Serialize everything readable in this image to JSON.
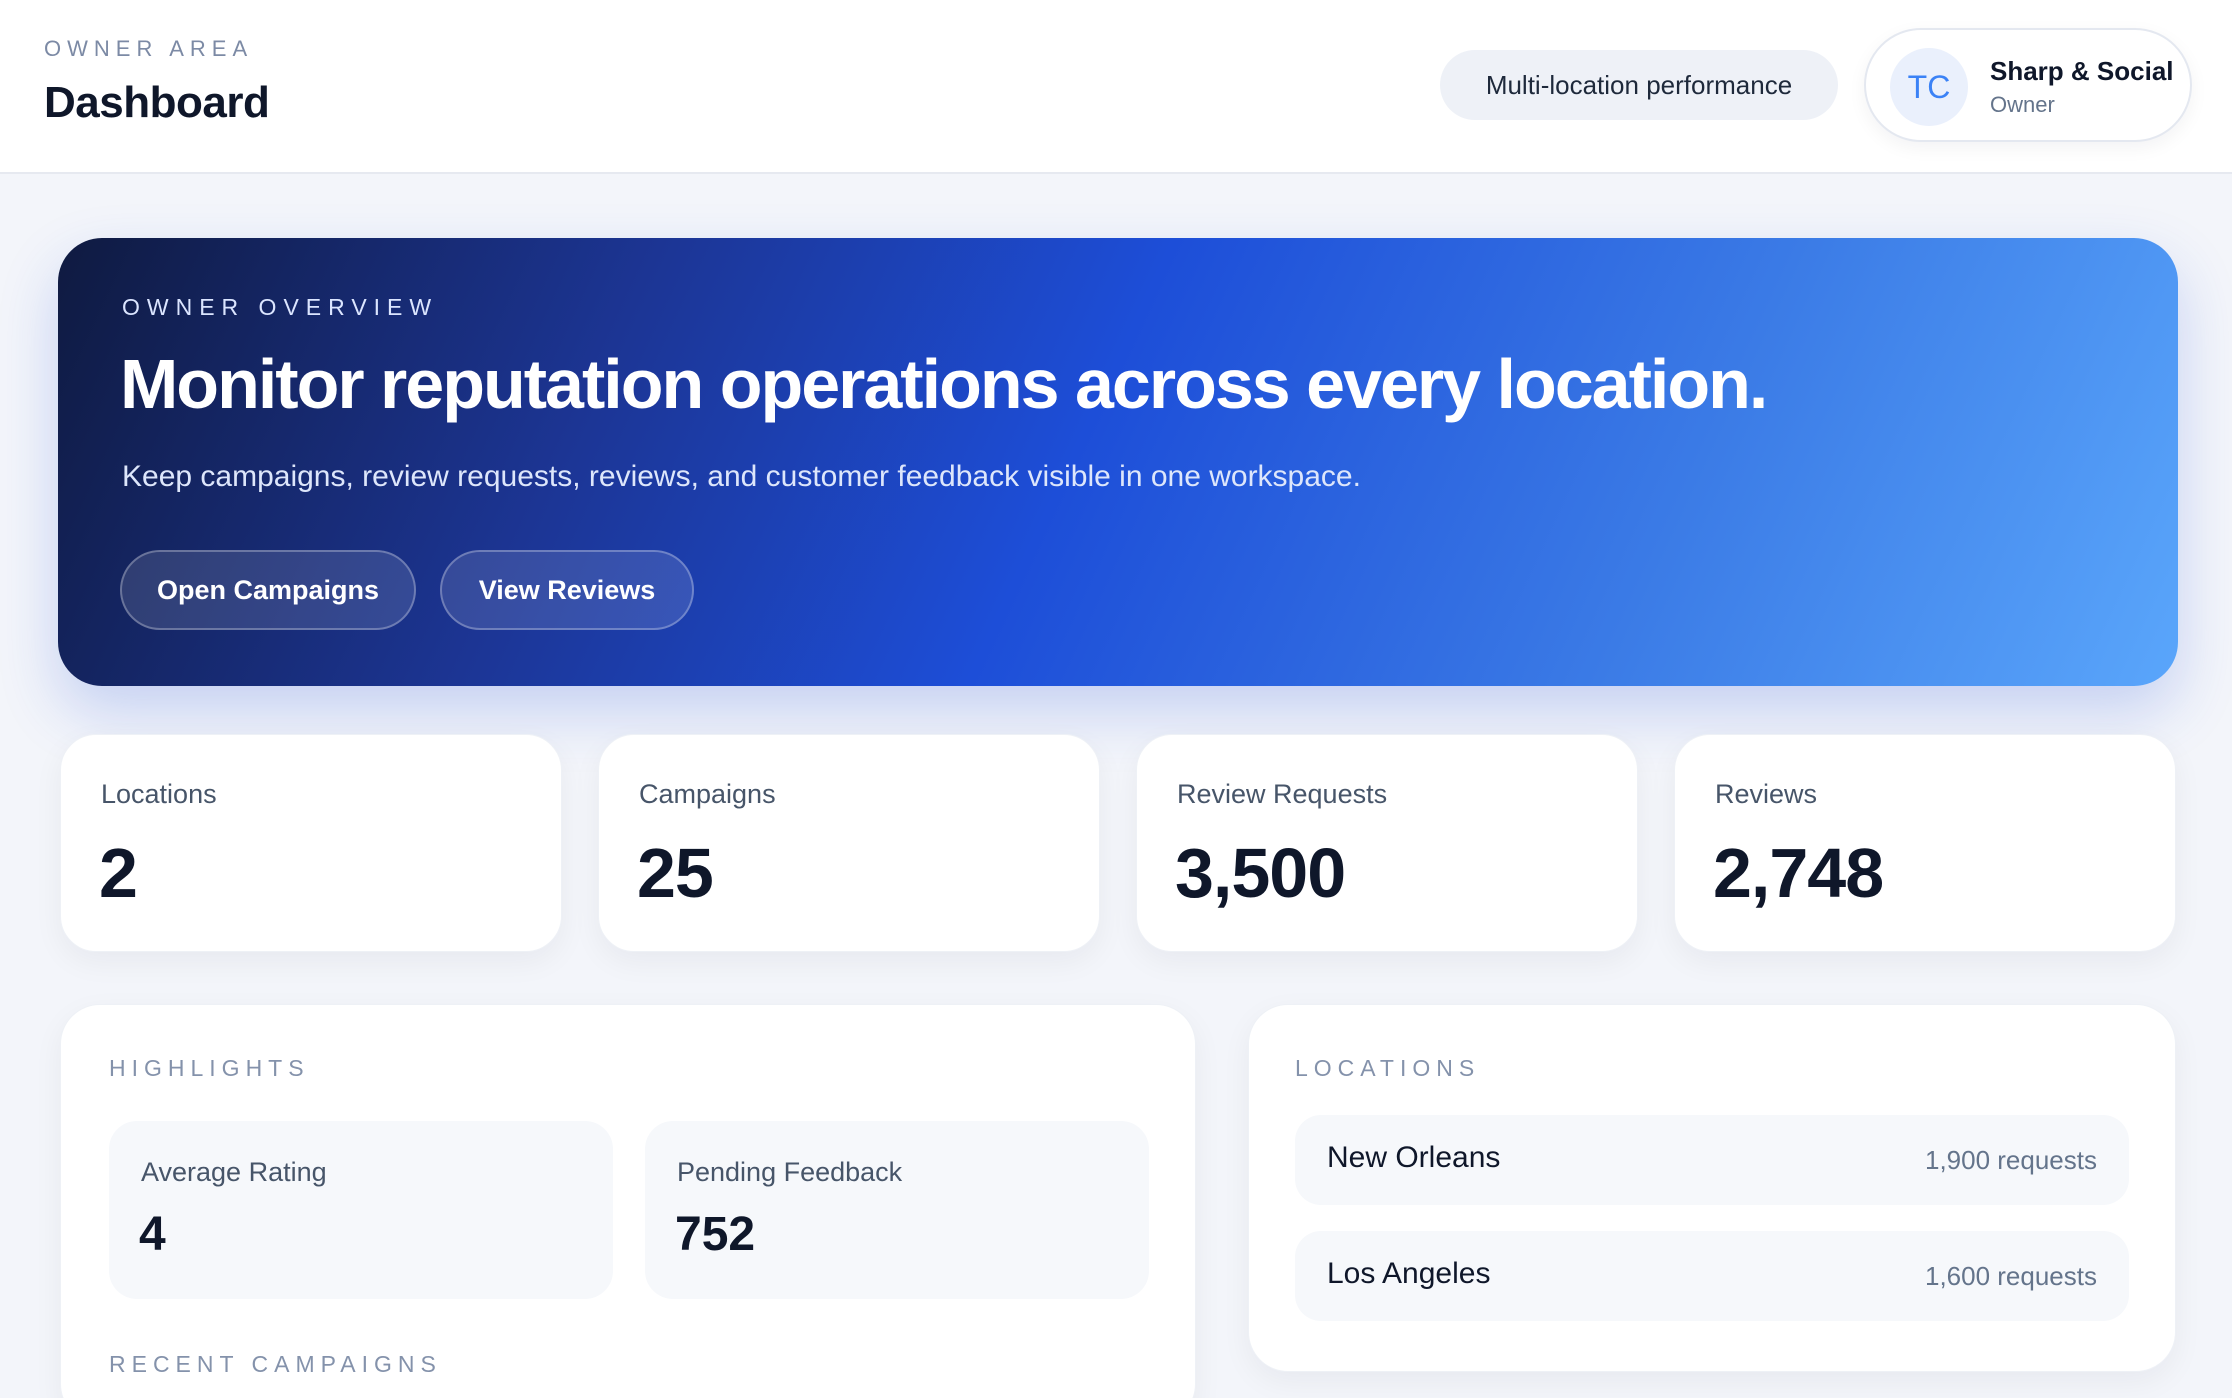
{
  "header": {
    "eyebrow": "OWNER AREA",
    "title": "Dashboard",
    "performance_pill": "Multi-location performance",
    "user": {
      "initials": "TC",
      "name": "Sharp & Social",
      "role": "Owner"
    }
  },
  "hero": {
    "eyebrow": "OWNER OVERVIEW",
    "title": "Monitor reputation operations across every location.",
    "subtitle": "Keep campaigns, review requests, reviews, and customer feedback visible in one workspace.",
    "buttons": [
      "Open Campaigns",
      "View Reviews"
    ]
  },
  "stats": [
    {
      "label": "Locations",
      "value": "2"
    },
    {
      "label": "Campaigns",
      "value": "25"
    },
    {
      "label": "Review Requests",
      "value": "3,500"
    },
    {
      "label": "Reviews",
      "value": "2,748"
    }
  ],
  "highlights": {
    "eyebrow": "HIGHLIGHTS",
    "items": [
      {
        "label": "Average Rating",
        "value": "4"
      },
      {
        "label": "Pending Feedback",
        "value": "752"
      }
    ],
    "recent_campaigns_eyebrow": "RECENT CAMPAIGNS"
  },
  "locations": {
    "eyebrow": "LOCATIONS",
    "items": [
      {
        "name": "New Orleans",
        "requests": "1,900 requests"
      },
      {
        "name": "Los Angeles",
        "requests": "1,600 requests"
      }
    ]
  },
  "colors": {
    "accent": "#1d4ed8",
    "hero_start": "#0f1a40",
    "hero_end": "#5aa6fb",
    "background": "#f3f5fa"
  }
}
